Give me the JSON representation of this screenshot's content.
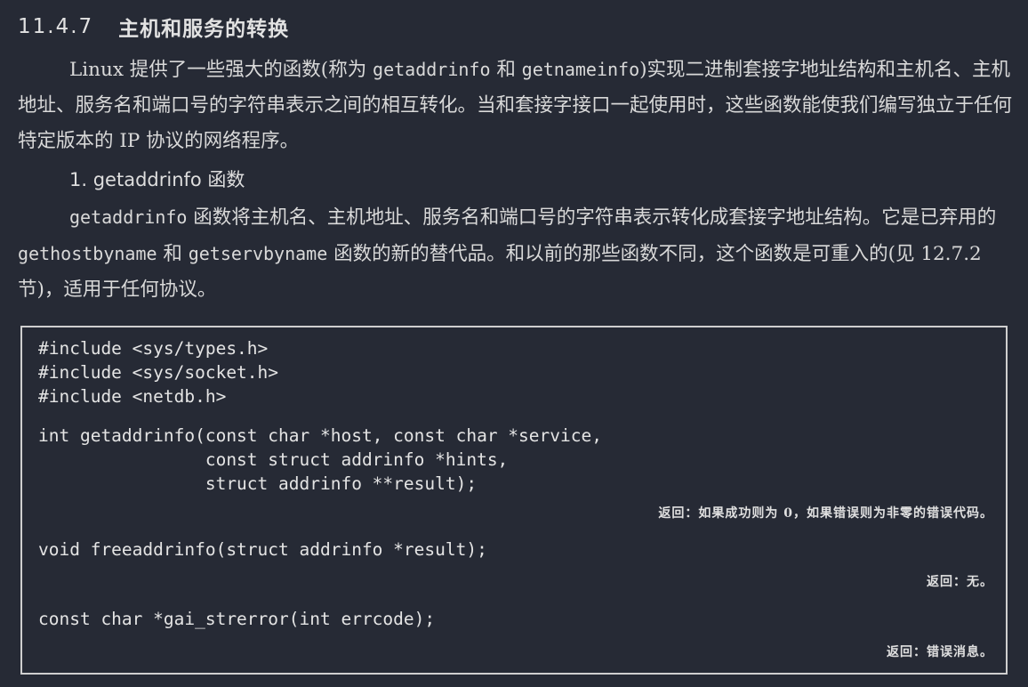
{
  "section": {
    "number": "11.4.7",
    "title": "主机和服务的转换"
  },
  "intro": {
    "p1_a": "Linux 提供了一些强大的函数(称为 ",
    "p1_code1": "getaddrinfo",
    "p1_b": " 和 ",
    "p1_code2": "getnameinfo",
    "p1_c": ")实现二进制套接字地址结构和主机名、主机地址、服务名和端口号的字符串表示之间的相互转化。当和套接字接口一起使用时，这些函数能使我们编写独立于任何特定版本的 IP 协议的网络程序。"
  },
  "subsection": {
    "label": "1. getaddrinfo 函数"
  },
  "para2": {
    "code1": "getaddrinfo",
    "a": " 函数将主机名、主机地址、服务名和端口号的字符串表示转化成套接字地址结构。它是已弃用的 ",
    "code2": "gethostbyname",
    "b": " 和 ",
    "code3": "getservbyname",
    "c": " 函数的新的替代品。和以前的那些函数不同，这个函数是可重入的(见 12.7.2 节)，适用于任何协议。"
  },
  "code": {
    "includes": "#include <sys/types.h>\n#include <sys/socket.h>\n#include <netdb.h>",
    "getaddrinfo_sig": "int getaddrinfo(const char *host, const char *service,\n                const struct addrinfo *hints,\n                struct addrinfo **result);",
    "getaddrinfo_ret": "返回：如果成功则为 0，如果错误则为非零的错误代码。",
    "freeaddrinfo_sig": "void freeaddrinfo(struct addrinfo *result);",
    "freeaddrinfo_ret": "返回：无。",
    "gai_strerror_sig": "const char *gai_strerror(int errcode);",
    "gai_strerror_ret": "返回：错误消息。"
  }
}
